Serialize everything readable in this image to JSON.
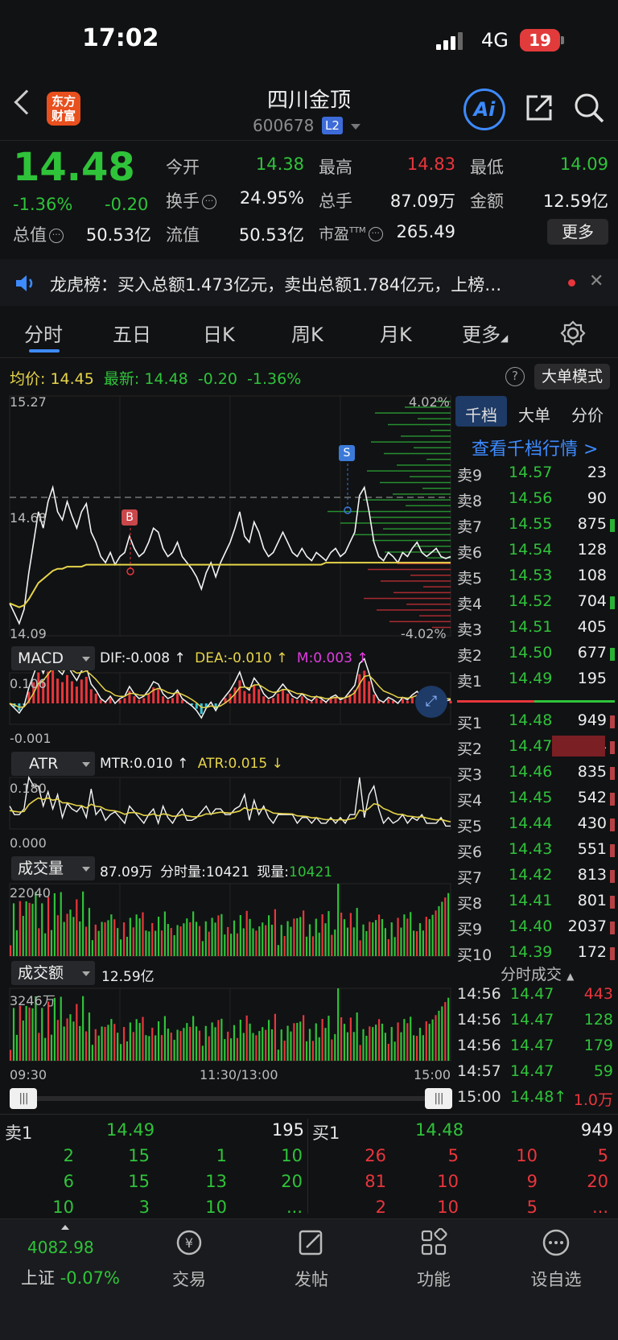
{
  "status_bar": {
    "time": "17:02",
    "network": "4G",
    "battery": "19"
  },
  "header": {
    "name": "四川金顶",
    "code": "600678",
    "level_badge": "L2",
    "logo_text_line1": "东方",
    "logo_text_line2": "财富",
    "ai_label": "Ai"
  },
  "quote": {
    "price": "14.48",
    "change_pct": "-1.36%",
    "change_abs": "-0.20",
    "open_label": "今开",
    "open": "14.38",
    "high_label": "最高",
    "high": "14.83",
    "low_label": "最低",
    "low": "14.09",
    "turnover_label": "换手",
    "turnover": "24.95%",
    "volume_label": "总手",
    "volume": "87.09万",
    "amount_label": "金额",
    "amount": "12.59亿",
    "mktcap_label": "总值",
    "mktcap": "50.53亿",
    "float_label": "流值",
    "float": "50.53亿",
    "pe_label": "市盈",
    "pe_sup": "TTM",
    "pe": "265.49",
    "more_button": "更多"
  },
  "news": {
    "text": "龙虎榜：买入总额1.473亿元，卖出总额1.784亿元，上榜…"
  },
  "tabs": [
    "分时",
    "五日",
    "日K",
    "周K",
    "月K",
    "更多"
  ],
  "active_tab": "分时",
  "chart_header": {
    "avg_label": "均价:",
    "avg": "14.45",
    "latest_label": "最新:",
    "latest": "14.48",
    "chg": "-0.20",
    "pct": "-1.36%",
    "big_order_button": "大单模式"
  },
  "main_chart": {
    "y_top": "15.27",
    "y_bottom": "14.09",
    "y_ref": "14.68",
    "pct_top": "4.02%",
    "pct_bottom": "-4.02%",
    "buy_marker": "B",
    "sell_marker": "S",
    "x_labels": [
      "09:30",
      "11:30/13:00",
      "15:00"
    ]
  },
  "chart_data": {
    "type": "line",
    "x_range": [
      "09:30",
      "15:00"
    ],
    "ylim": [
      14.09,
      15.27
    ],
    "reference_price": 14.68,
    "series": [
      {
        "name": "最新",
        "values": [
          14.25,
          14.2,
          14.15,
          14.22,
          14.4,
          14.55,
          14.7,
          14.62,
          14.75,
          14.82,
          14.7,
          14.66,
          14.75,
          14.68,
          14.62,
          14.7,
          14.74,
          14.6,
          14.55,
          14.48,
          14.45,
          14.5,
          14.44,
          14.48,
          14.5,
          14.58,
          14.52,
          14.48,
          14.5,
          14.55,
          14.62,
          14.6,
          14.52,
          14.48,
          14.5,
          14.55,
          14.48,
          14.45,
          14.42,
          14.38,
          14.32,
          14.4,
          14.45,
          14.38,
          14.45,
          14.5,
          14.55,
          14.62,
          14.7,
          14.58,
          14.55,
          14.65,
          14.6,
          14.52,
          14.48,
          14.5,
          14.55,
          14.6,
          14.55,
          14.5,
          14.48,
          14.52,
          14.48,
          14.46,
          14.5,
          14.48,
          14.46,
          14.5,
          14.52,
          14.48,
          14.5,
          14.55,
          14.6,
          14.78,
          14.82,
          14.7,
          14.55,
          14.48,
          14.46,
          14.5,
          14.48,
          14.45,
          14.5,
          14.48,
          14.52,
          14.55,
          14.5,
          14.48,
          14.5,
          14.52,
          14.48,
          14.47,
          14.48
        ]
      },
      {
        "name": "均价",
        "values": [
          14.25,
          14.24,
          14.23,
          14.24,
          14.27,
          14.31,
          14.35,
          14.37,
          14.39,
          14.41,
          14.42,
          14.42,
          14.43,
          14.43,
          14.43,
          14.43,
          14.44,
          14.44,
          14.44,
          14.44,
          14.44,
          14.44,
          14.44,
          14.44,
          14.44,
          14.44,
          14.44,
          14.44,
          14.44,
          14.44,
          14.44,
          14.44,
          14.44,
          14.44,
          14.44,
          14.44,
          14.44,
          14.44,
          14.44,
          14.44,
          14.44,
          14.44,
          14.44,
          14.44,
          14.44,
          14.44,
          14.44,
          14.44,
          14.44,
          14.44,
          14.44,
          14.44,
          14.44,
          14.44,
          14.44,
          14.44,
          14.44,
          14.44,
          14.44,
          14.44,
          14.44,
          14.44,
          14.44,
          14.44,
          14.44,
          14.44,
          14.45,
          14.45,
          14.45,
          14.45,
          14.45,
          14.45,
          14.45,
          14.45,
          14.45,
          14.45,
          14.45,
          14.45,
          14.45,
          14.45,
          14.45,
          14.45,
          14.45,
          14.45,
          14.45,
          14.45,
          14.45,
          14.45,
          14.45,
          14.45,
          14.45,
          14.45,
          14.45
        ]
      }
    ]
  },
  "macd": {
    "label": "MACD",
    "dif": "DIF:-0.008 ↑",
    "dea": "DEA:-0.010 ↑",
    "m": "M:0.003 ↑",
    "y_top": "0.106",
    "y_bottom": "-0.001"
  },
  "atr": {
    "label": "ATR",
    "mtr": "MTR:0.010 ↑",
    "atr": "ATR:0.015 ↓",
    "y_top": "0.180",
    "y_bottom": "0.000"
  },
  "vol": {
    "label": "成交量",
    "total": "87.09万",
    "minute_label": "分时量:",
    "minute": "10421",
    "now_label": "现量:",
    "now": "10421",
    "y_top": "22040"
  },
  "amt": {
    "label": "成交额",
    "total": "12.59亿",
    "y_top": "3246万"
  },
  "right_panel": {
    "tabs": [
      "千档",
      "大单",
      "分价"
    ],
    "link": "查看千档行情 >",
    "asks": [
      {
        "label": "卖9",
        "price": "14.57",
        "vol": "23"
      },
      {
        "label": "卖8",
        "price": "14.56",
        "vol": "90"
      },
      {
        "label": "卖7",
        "price": "14.55",
        "vol": "875"
      },
      {
        "label": "卖6",
        "price": "14.54",
        "vol": "128"
      },
      {
        "label": "卖5",
        "price": "14.53",
        "vol": "108"
      },
      {
        "label": "卖4",
        "price": "14.52",
        "vol": "704"
      },
      {
        "label": "卖3",
        "price": "14.51",
        "vol": "405"
      },
      {
        "label": "卖2",
        "price": "14.50",
        "vol": "677"
      },
      {
        "label": "卖1",
        "price": "14.49",
        "vol": "195"
      }
    ],
    "bids": [
      {
        "label": "买1",
        "price": "14.48",
        "vol": "949"
      },
      {
        "label": "买2",
        "price": "14.47",
        "vol": "4694"
      },
      {
        "label": "买3",
        "price": "14.46",
        "vol": "835"
      },
      {
        "label": "买4",
        "price": "14.45",
        "vol": "542"
      },
      {
        "label": "买5",
        "price": "14.44",
        "vol": "430"
      },
      {
        "label": "买6",
        "price": "14.43",
        "vol": "551"
      },
      {
        "label": "买7",
        "price": "14.42",
        "vol": "813"
      },
      {
        "label": "买8",
        "price": "14.41",
        "vol": "801"
      },
      {
        "label": "买9",
        "price": "14.40",
        "vol": "2037"
      },
      {
        "label": "买10",
        "price": "14.39",
        "vol": "172"
      }
    ],
    "trades_title": "分时成交",
    "trades": [
      {
        "time": "14:56",
        "price": "14.47",
        "vol": "443"
      },
      {
        "time": "14:56",
        "price": "14.47",
        "vol": "128"
      },
      {
        "time": "14:56",
        "price": "14.47",
        "vol": "179"
      },
      {
        "time": "14:57",
        "price": "14.47",
        "vol": "59"
      },
      {
        "time": "15:00",
        "price": "14.48↑",
        "vol": "1.0万"
      }
    ]
  },
  "bottom_quote": {
    "sell1_label": "卖1",
    "sell1_price": "14.49",
    "sell1_vol": "195",
    "buy1_label": "买1",
    "buy1_price": "14.48",
    "buy1_vol": "949",
    "sell_queue": [
      [
        "2",
        "15",
        "1",
        "10"
      ],
      [
        "6",
        "15",
        "13",
        "20"
      ],
      [
        "10",
        "3",
        "10",
        "..."
      ]
    ],
    "buy_queue": [
      [
        "26",
        "5",
        "10",
        "5"
      ],
      [
        "81",
        "10",
        "9",
        "20"
      ],
      [
        "2",
        "10",
        "5",
        "..."
      ]
    ]
  },
  "nav": {
    "index_value": "4082.98",
    "index_name": "上证",
    "index_pct": "-0.07%",
    "items": [
      "交易",
      "发帖",
      "功能",
      "设自选"
    ]
  }
}
